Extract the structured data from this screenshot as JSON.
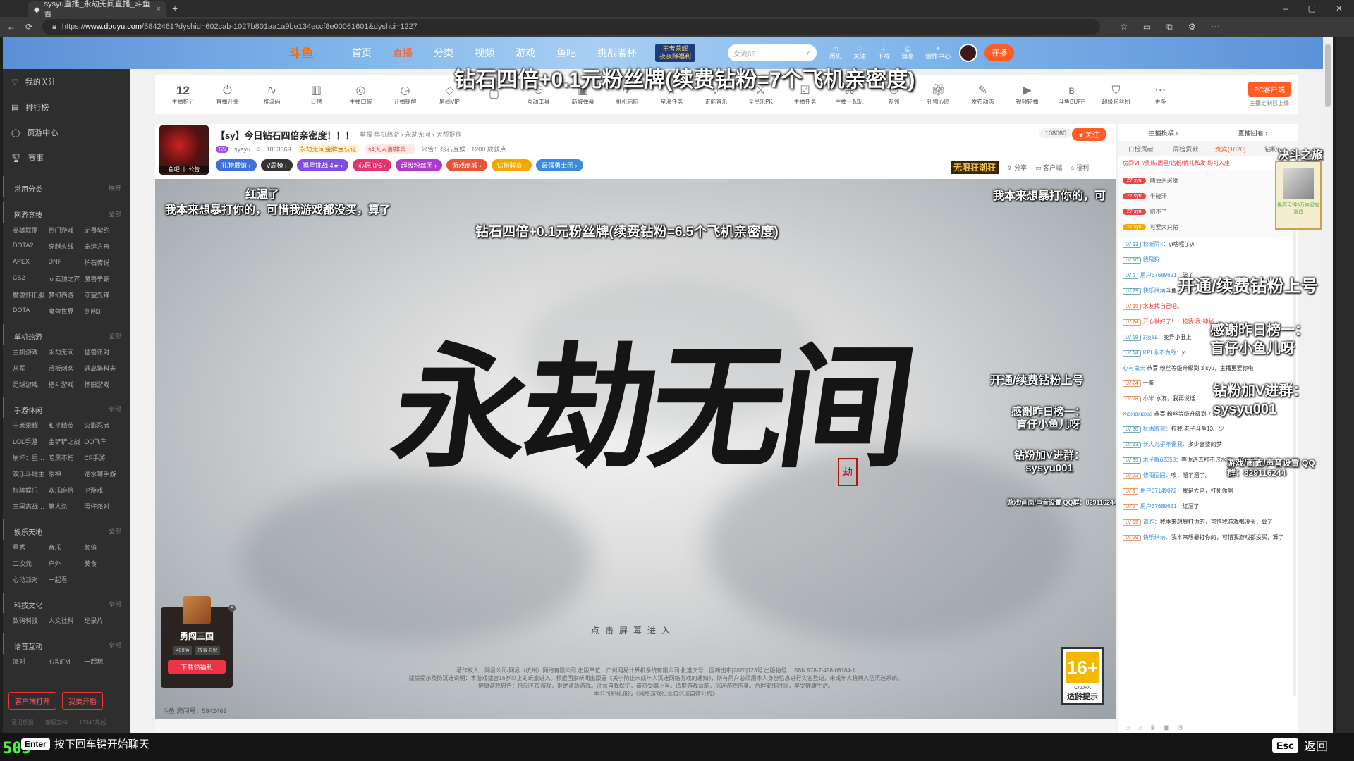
{
  "browser": {
    "tab_title": "sysyu直播_永劫无间直播_斗鱼直",
    "new_tab": "+",
    "tab_close": "×",
    "url_prefix": "https://",
    "url_host": "www.douyu.com",
    "url_path": "/5842461?dyshid=602cab-1027b801aa1a9be134eccf8e00061601&dyshci=1227",
    "win_min": "–",
    "win_max": "▢",
    "win_close": "✕"
  },
  "header": {
    "logo": "斗鱼",
    "nav": [
      "首页",
      "直播",
      "分类",
      "视频",
      "游戏",
      "鱼吧",
      "挑战者杯"
    ],
    "promo_line1": "王者荣耀",
    "promo_line2": "夜夜赚福利",
    "search_placeholder": "女流66",
    "icons": [
      "历史",
      "关注",
      "下载",
      "消息",
      "创作中心"
    ],
    "start_live": "开播"
  },
  "sidebar": {
    "main": [
      "我的关注",
      "排行榜",
      "页游中心",
      "赛事"
    ],
    "sections": [
      {
        "title": "常用分类",
        "all": "展开",
        "items": []
      },
      {
        "title": "网游竞技",
        "all": "全部",
        "items": [
          "英雄联盟",
          "热门游戏",
          "无畏契约",
          "DOTA2",
          "穿越火线",
          "命运方舟",
          "APEX",
          "DNF",
          "炉石传说",
          "CS2",
          "lol云顶之弈",
          "魔兽争霸",
          "魔兽怀旧服",
          "梦幻西游",
          "守望先锋",
          "DOTA",
          "魔兽世界",
          "剑网3"
        ]
      },
      {
        "title": "单机热游",
        "all": "全部",
        "items": [
          "主机游戏",
          "永劫无间",
          "猛兽派对",
          "从军",
          "滑板刺客",
          "逃离塔科夫",
          "足球游戏",
          "格斗游戏",
          "怀旧游戏"
        ]
      },
      {
        "title": "手游休闲",
        "all": "全部",
        "items": [
          "王者荣耀",
          "和平精英",
          "火影忍者",
          "LOL手游",
          "金铲铲之战",
          "QQ飞车",
          "崩坏：星…",
          "暗黑不朽",
          "CF手游",
          "欢乐斗地主",
          "原神",
          "逆水寒手游",
          "棋牌娱乐",
          "欢乐麻将",
          "IP游戏",
          "三国志战…",
          "第人杀",
          "蛋仔派对"
        ]
      },
      {
        "title": "娱乐天地",
        "all": "全部",
        "items": [
          "星秀",
          "音乐",
          "颜值",
          "二次元",
          "户外",
          "美食",
          "心动派对",
          "一起看"
        ]
      },
      {
        "title": "科技文化",
        "all": "全部",
        "items": [
          "数码科技",
          "人文社科",
          "纪录片"
        ]
      },
      {
        "title": "语音互动",
        "all": "全部",
        "items": [
          "派对",
          "心动FM",
          "一起玩"
        ]
      }
    ],
    "btn_client": "客户端打开",
    "btn_live": "我要开播",
    "footer": [
      "意见反馈",
      "客服支持",
      "12345热线"
    ]
  },
  "toolbar": {
    "score_num": "12",
    "items": [
      "主播积分",
      "直播开关",
      "推流码",
      "日榜",
      "主播口袋",
      "开播提醒",
      "房间VIP",
      "",
      "互动工具",
      "商城弹幕",
      "挑机启航",
      "星海任务",
      "正能音乐",
      "全民乐PK",
      "主播任务",
      "主播一起玩",
      "友邻",
      "礼物心愿",
      "发布动态",
      "视频轮播",
      "斗鱼BUFF",
      "超级粉丝团",
      "更多"
    ],
    "pc_btn": "PC客户端",
    "pc_sub": "主播定制已上线"
  },
  "room": {
    "avatar_label": "鱼吧 丨 公告",
    "title": "【sy】今日钻石四倍亲密度！！！",
    "category": "举报   单机热游 › 永劫无间 › 大帮提作",
    "level": "65",
    "name": "sysyu",
    "heat": "1853369",
    "tag1": "永劫无间金牌宝认证",
    "tag2": "s4天人御排第一",
    "notice": "公告：炫石互娱",
    "fans": "1200 成就点",
    "badges": [
      "礼物展馆 ›",
      "V周榜 ›",
      "福星挑战 4★ ›",
      "心愿 0/6 ›",
      "超级粉丝团 ›",
      "游戏商城 ›",
      "钻粉联赛 ›",
      "最强勇士团 ›"
    ],
    "follow_count": "108060",
    "follow": "♥ 关注",
    "promo": "无限狂潮狂",
    "actions": [
      "分享",
      "客户端",
      "福利"
    ]
  },
  "overlay": {
    "top_banner": "钻石四倍+0.1元粉丝牌(续费钻粉=7个飞机亲密度)",
    "hot": "红温了",
    "line2": "我本来想暴打你的，可惜我游戏都没买，算了",
    "right_top": "我本来想暴打你的，可",
    "center": "钻石四倍+0.1元粉丝牌(续费钻粉=6.5个飞机亲密度)",
    "subscribe": "开通/续费钻粉上号",
    "thanks1": "感谢昨日榜一：",
    "thanks2": "盲仔小鱼儿呀",
    "qq1": "钻粉加V进群：",
    "qq2": "sysyu001",
    "qq_small": "游戏/画面/声音设置 QQ群：829116244",
    "click_enter": "点击屏幕进入",
    "copyright1": "著作权人：网易公司/网易（杭州）网络有限公司  出版单位：广州网易计算机系统有限公司  批准文号：国新出审[2020]123号  出版物号：ISBN 978-7-498-08184-1",
    "copyright2": "适龄提示及防沉迷说明：本游戏适合16岁以上的玩家进入。根据国家新闻出版署《关于防止未成年人沉迷网络游戏的通知》，所有用户必须用本人身份信息进行实名登记，未成年人将纳入防沉迷系统。",
    "copyright3": "健康游戏忠告：抵制不良游戏，拒绝盗版游戏。注意自我保护，谨防受骗上当。适度游戏益脑，沉迷游戏伤身。合理安排时间，享受健康生活。",
    "copyright4": "本公司积极履行《网络游戏行业防沉迷自律公约》",
    "room_num": "斗鱼 房间号：5842461",
    "seal": "劫",
    "calligraphy": "永劫无间"
  },
  "age_badge": {
    "age": "16+",
    "cadpa": "CADPA",
    "text": "适龄提示"
  },
  "game_ad": {
    "name": "勇闯三国",
    "tag1": "400抽",
    "tag2": "放置卡牌",
    "download": "下载领福利"
  },
  "chat": {
    "top": [
      "主播投稿 ›",
      "直播回看 ›"
    ],
    "tabs": [
      "日榜贡献",
      "周榜贡献",
      "贵宾(1020)",
      "钻粉(…"
    ],
    "vip_line": "房间VIP/贵族/周星/钻粉/优礼私发  均可入座",
    "pinned": [
      {
        "fans": "27 syu",
        "text": "随便买买喽"
      },
      {
        "fans": "27 syu",
        "text": "半碗汗"
      },
      {
        "fans": "27 syu",
        "text": "赔不了"
      },
      {
        "fans": "27 syu",
        "text": "可爱大只猪"
      }
    ],
    "messages": [
      {
        "lv": "LV 33",
        "user": "秋昕雨~：",
        "text": "yi啥呢了yi"
      },
      {
        "lv": "LV 10",
        "user": "我是狗",
        "text": ""
      },
      {
        "lv": "LV 2",
        "user": "用户57689621：",
        "text": "破了"
      },
      {
        "lv": "LV 29",
        "user": "快乐纳纳",
        "text": "斗鱼 ·  13少"
      },
      {
        "lv": "LV 35",
        "user": "",
        "text": "水友找自己吧。"
      },
      {
        "lv": "LV 24",
        "user": "开心就好了！：",
        "text": "拉我  我 神秘"
      },
      {
        "lv": "LV 18",
        "user": "z技aa：",
        "text": "变异小丑上"
      },
      {
        "lv": "LV 14",
        "user": "KPL永不为敌：",
        "text": "yi"
      },
      {
        "lv": "",
        "user": "心有南天",
        "text": "恭喜  粉丝等级升级到 3 syu，主播更爱你啦"
      },
      {
        "lv": "LV 24",
        "user": "",
        "text": "一条"
      },
      {
        "lv": "LV 28",
        "user": "小米",
        "text": "水友，我再说话"
      },
      {
        "lv": "",
        "user": "Xiaxiaxiaxia",
        "text": "恭喜  粉丝等级升级到 7 syu，主播更爱你啦"
      },
      {
        "lv": "LV 30",
        "user": "秋雨寂寥：",
        "text": "拉我 老子斗鱼13、少"
      },
      {
        "lv": "LV 13",
        "user": "长大儿子不像我：",
        "text": "多少富婆的梦"
      },
      {
        "lv": "LV 35",
        "user": "木子靓62358：",
        "text": "等你进去打不过水友，我再说话"
      },
      {
        "lv": "LV 22",
        "user": "修雨囧囧：",
        "text": "唉，溜了溜了。"
      },
      {
        "lv": "LV 9",
        "user": "用户07149072：",
        "text": "我是大佬，打死你啊"
      },
      {
        "lv": "LV 2",
        "user": "用户57689621：",
        "text": "红温了"
      },
      {
        "lv": "LV 19",
        "user": "道昨：",
        "text": "我本来想暴打你的，可惜我游戏都没买，算了"
      },
      {
        "lv": "LV 29",
        "user": "快乐纳纳：",
        "text": "我本来想暴打你的，可惜我游戏都没买，算了"
      }
    ],
    "shake": "决斗之旅",
    "treasure_text": "最高可得5万亲密度道具"
  },
  "bottom": {
    "enter_key": "Enter",
    "enter_text": "按下回车键开始聊天",
    "esc_key": "Esc",
    "esc_text": "返回",
    "fps": "505"
  }
}
